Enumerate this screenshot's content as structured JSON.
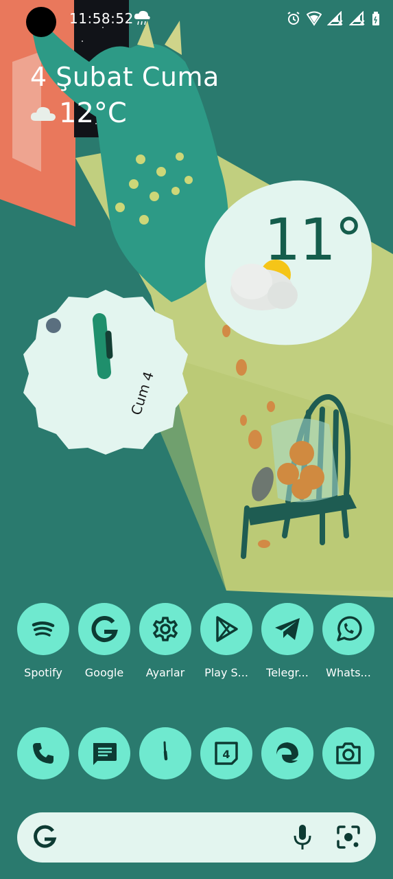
{
  "status_bar": {
    "time": "11:58:52",
    "icons": [
      "weather-rain-icon",
      "alarm-icon",
      "wifi-icon",
      "signal-1-icon",
      "signal-2-icon",
      "battery-icon"
    ]
  },
  "date_widget": {
    "date": "4 Şubat Cuma",
    "temperature": "12°C",
    "weather_icon": "cloud-icon"
  },
  "weather_widget": {
    "temperature": "11°",
    "condition_icon": "partly-cloudy-icon"
  },
  "clock_widget": {
    "date_label": "Cum 4"
  },
  "apps": [
    {
      "label": "Spotify",
      "icon": "spotify-icon"
    },
    {
      "label": "Google",
      "icon": "google-icon"
    },
    {
      "label": "Ayarlar",
      "icon": "settings-icon"
    },
    {
      "label": "Play S...",
      "icon": "play-store-icon"
    },
    {
      "label": "Telegr...",
      "icon": "telegram-icon"
    },
    {
      "label": "Whats...",
      "icon": "whatsapp-icon"
    }
  ],
  "dock": [
    {
      "icon": "phone-icon"
    },
    {
      "icon": "messages-icon"
    },
    {
      "icon": "clock-icon"
    },
    {
      "icon": "calendar-icon",
      "text": "4"
    },
    {
      "icon": "edge-browser-icon"
    },
    {
      "icon": "camera-icon"
    }
  ],
  "search_bar": {
    "icons": [
      "google-g-icon",
      "microphone-icon",
      "lens-icon"
    ]
  },
  "colors": {
    "background": "#2a7a6e",
    "icon_bg": "#6fe9cf",
    "icon_fg": "#0d3b33",
    "widget_bg": "#e3f5ef"
  }
}
